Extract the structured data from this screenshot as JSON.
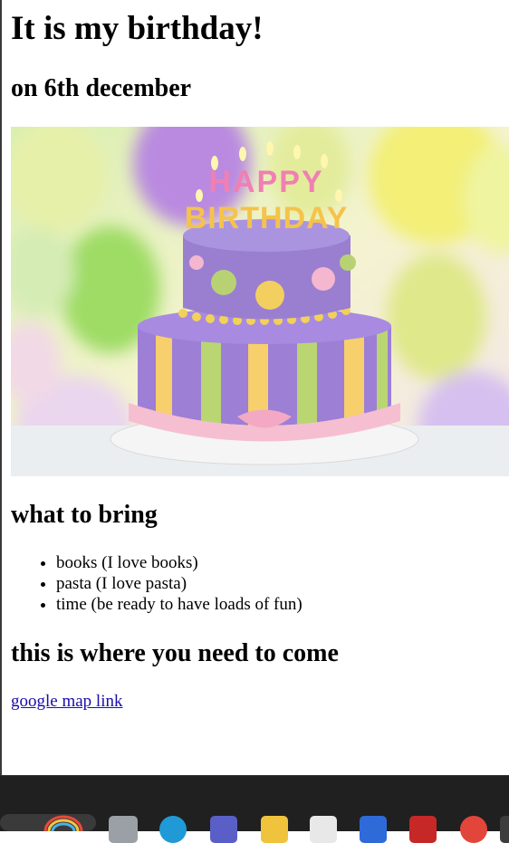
{
  "page": {
    "title": "It is my birthday!",
    "date": "on 6th december",
    "bring_heading": "what to bring",
    "bring_items": [
      "books (I love books)",
      "pasta (I love pasta)",
      "time (be ready to have loads of fun)"
    ],
    "where_heading": "this is where you need to come",
    "map_link": "google map link"
  },
  "cake_candles": "HAPPY BIRTHDAY",
  "taskbar": {
    "icons": [
      "rainbow-icon",
      "files-icon",
      "edge-icon",
      "teams-icon",
      "folder-icon",
      "store-icon",
      "vs-icon",
      "gmail-icon",
      "chrome-icon"
    ]
  },
  "colors": {
    "link": "#1a0dab",
    "taskbar": "#202020"
  }
}
